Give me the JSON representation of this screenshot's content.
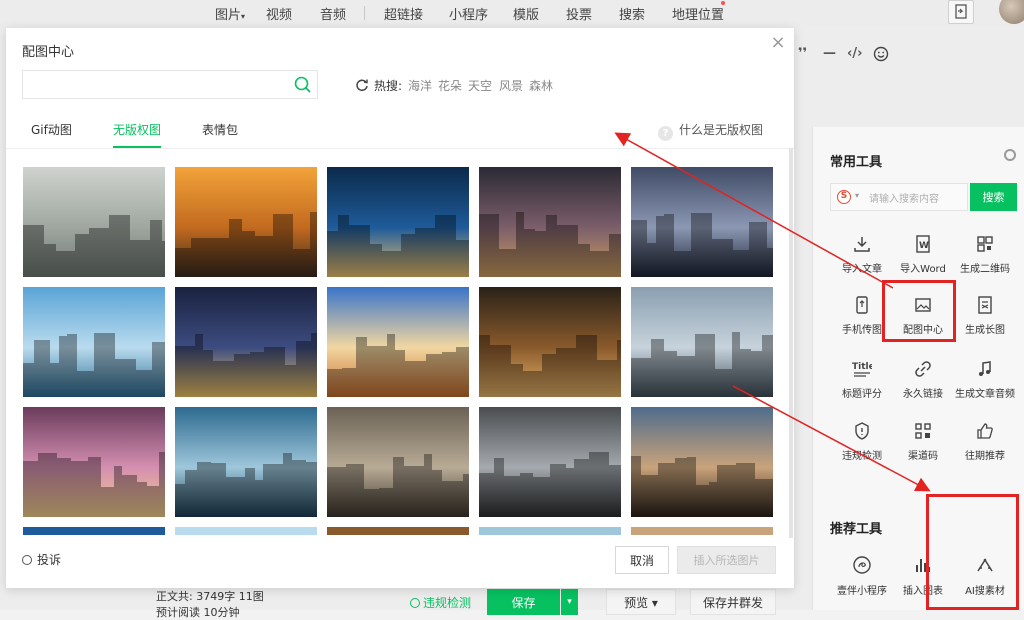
{
  "topbar": {
    "menu": [
      "图片",
      "视频",
      "音频",
      "超链接",
      "小程序",
      "模版",
      "投票",
      "搜索",
      "地理位置"
    ],
    "picture_caret": "▾"
  },
  "format_toolbar": [
    "❜❜",
    "—",
    "‹/›"
  ],
  "modal": {
    "title": "配图中心",
    "close": "×",
    "search_placeholder": "",
    "hot_label": "热搜:",
    "hot_words": [
      "海洋",
      "花朵",
      "天空",
      "风景",
      "森林"
    ],
    "tabs": [
      "Gif动图",
      "无版权图",
      "表情包"
    ],
    "active_tab": "无版权图",
    "help_text": "什么是无版权图",
    "report": "投诉",
    "cancel": "取消",
    "insert": "插入所选图片"
  },
  "images": [
    [
      "street-dancer-with-red-scarf",
      "city-sunset-skyline",
      "city-night-light-trails",
      "night-street-storefronts",
      "foggy-city-at-dusk"
    ],
    [
      "waterfront-city-aerial",
      "twin-towers-at-night",
      "riverside-town-sunset",
      "lamp-lit-alley-at-dusk",
      "skyline-aerial-at-sunrise"
    ],
    [
      "castle-over-city-lights",
      "glass-skyscraper-looking-up",
      "surreal-folded-city",
      "angel-statue-over-city",
      "wooden-bridge-over-canal"
    ]
  ],
  "side_panel": {
    "common_tools_title": "常用工具",
    "search_placeholder": "请输入搜索内容",
    "search_button": "搜索",
    "tools": [
      [
        "导入文章",
        "导入Word",
        "生成二维码"
      ],
      [
        "手机传图",
        "配图中心",
        "生成长图"
      ],
      [
        "标题评分",
        "永久链接",
        "生成文章音频"
      ],
      [
        "违规检测",
        "渠道码",
        "往期推荐"
      ]
    ],
    "recommended_title": "推荐工具",
    "recommended": [
      "壹伴小程序",
      "插入图表",
      "AI搜素材"
    ]
  },
  "bottom_bar": {
    "stats_prefix": "正文共:",
    "word_count": "3749字 11图",
    "stats_line2": "预计阅读 10分钟",
    "violation": "违规检测",
    "save": "保存",
    "preview": "预览",
    "publish": "保存并群发"
  },
  "colors": {
    "accent": "#07c160",
    "annotation_red": "#e32222"
  }
}
